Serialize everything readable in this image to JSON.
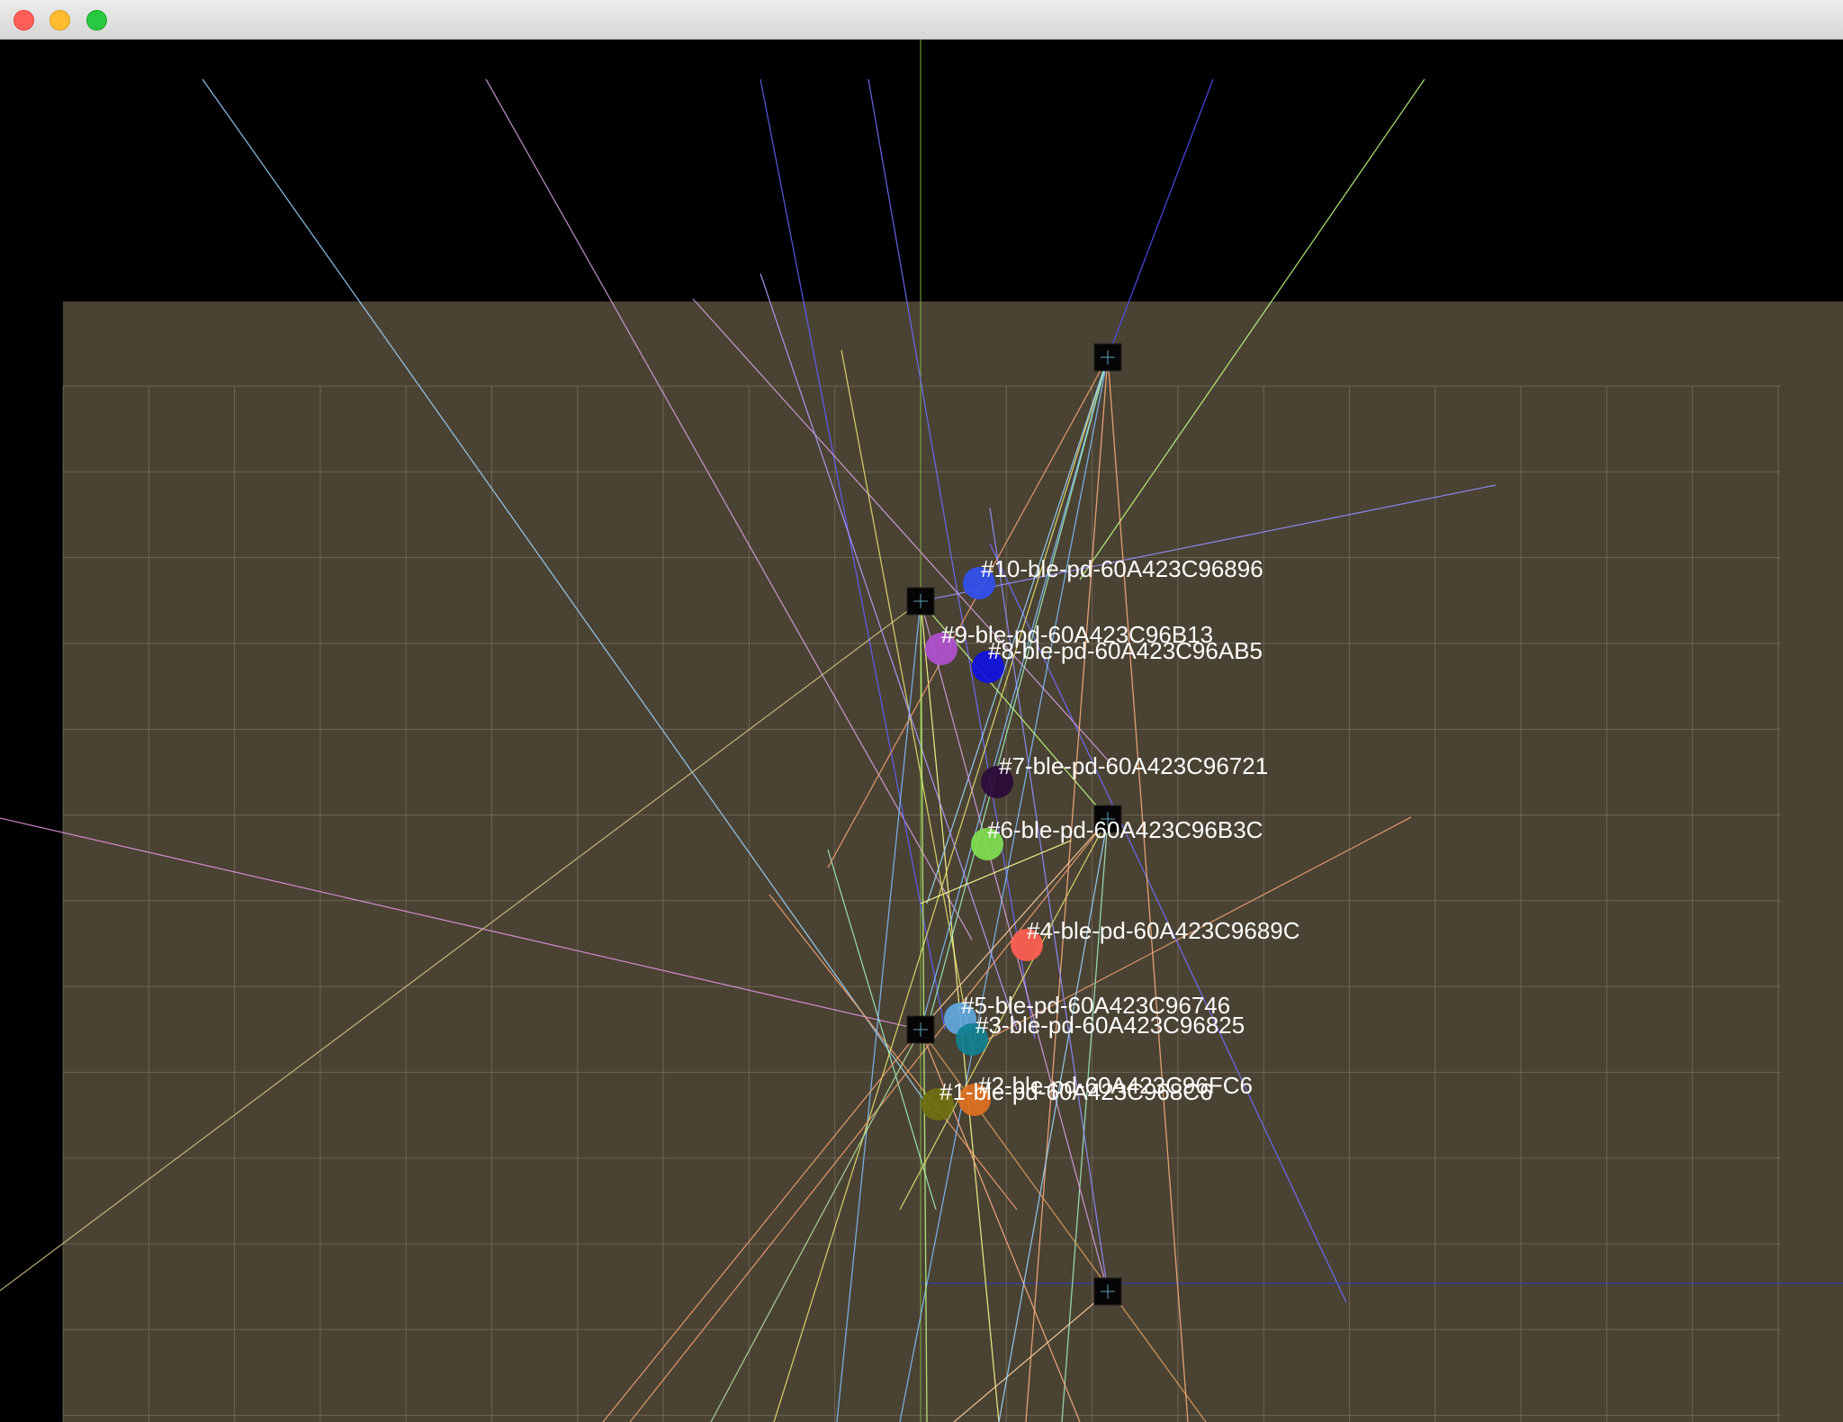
{
  "window": {
    "buttons": [
      {
        "name": "close",
        "color": "#ff5f57"
      },
      {
        "name": "minimize",
        "color": "#febc2e"
      },
      {
        "name": "maximize",
        "color": "#28c840"
      }
    ]
  },
  "scene": {
    "background_color": "#000000",
    "floor_color": "#4a4233",
    "grid_color": "#8a8270",
    "axis_color": "#7fb040"
  },
  "anchors": [
    {
      "id": "anchor-top-right"
    },
    {
      "id": "anchor-upper-left"
    },
    {
      "id": "anchor-middle-right"
    },
    {
      "id": "anchor-lower-left"
    },
    {
      "id": "anchor-bottom-right"
    }
  ],
  "devices": [
    {
      "label": "#10-ble-pd-60A423C96896",
      "color": "#3050f0"
    },
    {
      "label": "#9-ble-pd-60A423C96B13",
      "color": "#b050d0"
    },
    {
      "label": "#8-ble-pd-60A423C96AB5",
      "color": "#1010e0"
    },
    {
      "label": "#7-ble-pd-60A423C96721",
      "color": "#2a0a3a"
    },
    {
      "label": "#6-ble-pd-60A423C96B3C",
      "color": "#80e050"
    },
    {
      "label": "#4-ble-pd-60A423C9689C",
      "color": "#ff6050"
    },
    {
      "label": "#5-ble-pd-60A423C96746",
      "color": "#60a8e0"
    },
    {
      "label": "#3-ble-pd-60A423C96825",
      "color": "#108090"
    },
    {
      "label": "#2-ble-pd-60A423C96FC6",
      "color": "#e07020"
    },
    {
      "label": "#1-ble-pd-60A423C968C6",
      "color": "#707010"
    }
  ]
}
